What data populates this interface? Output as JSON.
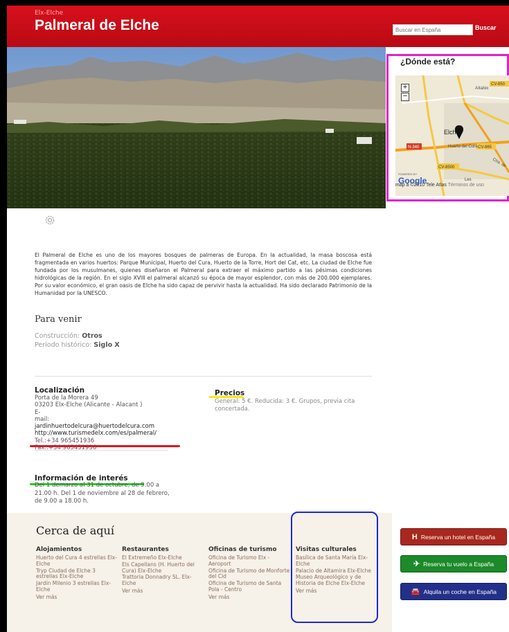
{
  "header": {
    "site_small": "Elx-Elche",
    "title": "Palmeral de Elche",
    "search_placeholder": "Buscar en España",
    "search_button": "Buscar"
  },
  "map": {
    "title": "¿Dónde está?",
    "labels": [
      "Altabix",
      "Elche",
      "Huerto del Cura",
      "N-340",
      "CV-865",
      "CV-8500",
      "Les",
      "CV-850",
      "Ctra. de"
    ],
    "powered_by": "POWERED BY",
    "google": "Google",
    "footer_data": "map a ©2010 Tele Atlas",
    "footer_terms": "Términos de uso"
  },
  "description": "El Palmeral de Elche es uno de los mayores bosques de palmeras de Europa. En la actualidad, la masa boscosa está fragmentada en varios huertos: Parque Municipal, Huerto del Cura, Huerto de la Torre, Hort del Cat, etc. La ciudad de Elche fue fundada por los musulmanes, quienes diseñaron el Palmeral para extraer el máximo partido a las pésimas condiciones hidrológicas de la región. En el siglo XVIII el palmeral alcanzó su época de mayor esplendor, con más de 200.000 ejemplares. Por su valor económico, el gran oasis de Elche ha sido capaz de pervivir hasta la actualidad. Ha sido declarado Patrimonio de la Humanidad por la UNESCO.",
  "para_venir": {
    "title": "Para venir",
    "construccion_label": "Construcción:",
    "construccion_value": "Otros",
    "periodo_label": "Periodo histórico:",
    "periodo_value": "Siglo X"
  },
  "localizacion": {
    "title": "Localización",
    "address1": "Porta de la Morera 49",
    "address2": "03203 Elx-Elche (Alicante - Alacant )",
    "email_label1": "E-",
    "email_label2": "mail:",
    "email": "jardinhuertodelcura@huertodelcura.com",
    "url": "http://www.turismedelx.com/es/palmeral/",
    "tel": "Tel.:+34 965451936",
    "fax": "Fax.:+34 965451936"
  },
  "precios": {
    "title": "Precios",
    "text": "General: 5 €. Reducida: 3 €. Grupos, previa cita concertada."
  },
  "informacion": {
    "title": "Información de interés",
    "text": "Del 1 demarzo al 31 de octubre, de 9.00 a 21.00 h. Del 1 de noviembre al 28 de febrero, de 9.00 a 18.00 h."
  },
  "cerca": {
    "title": "Cerca de aquí",
    "more": "Ver más",
    "columns": [
      {
        "title": "Alojamientos",
        "items": [
          "Huerto del Cura 4 estrellas Elx-Elche",
          "Tryp Ciudad de Elche 3 estrellas Elx-Elche",
          "Jardín Milenio 3 estrellas Elx-Elche"
        ]
      },
      {
        "title": "Restaurantes",
        "items": [
          "El Extremeño Elx-Elche",
          "Els Capellans (H. Huerto del Cura) Elx-Elche",
          "Trattoria Donnadry SL. Elx-Elche"
        ]
      },
      {
        "title": "Oficinas de turismo",
        "items": [
          "Oficina de Turismo Elx - Aeroport",
          "Oficina de Turismo de Monforte del Cid",
          "Oficina de Turismo de Santa Pola - Centro"
        ]
      },
      {
        "title": "Visitas culturales",
        "items": [
          "Basílica de Santa María Elx-Elche",
          "Palacio de Altamira Elx-Elche",
          "Museo Arqueológico y de Historia de Elche Elx-Elche"
        ]
      }
    ]
  },
  "sidebar": {
    "hotel_icon": "H",
    "hotel": "Reserva un hotel en España",
    "flight_icon": "✈",
    "flight": "Reserva tu vuelo a España",
    "car_icon": "🚘",
    "car": "Alquila un coche en España"
  },
  "colors": {
    "header_red": "#d8101c",
    "map_highlight": "#e020d0",
    "cultural_highlight": "#1d28d8",
    "underline_red": "#e3141c",
    "underline_yellow": "#f5ea12",
    "underline_green": "#20d020",
    "btn_hotel": "#a8281e",
    "btn_flight": "#1d8a2a",
    "btn_car": "#23308a"
  }
}
